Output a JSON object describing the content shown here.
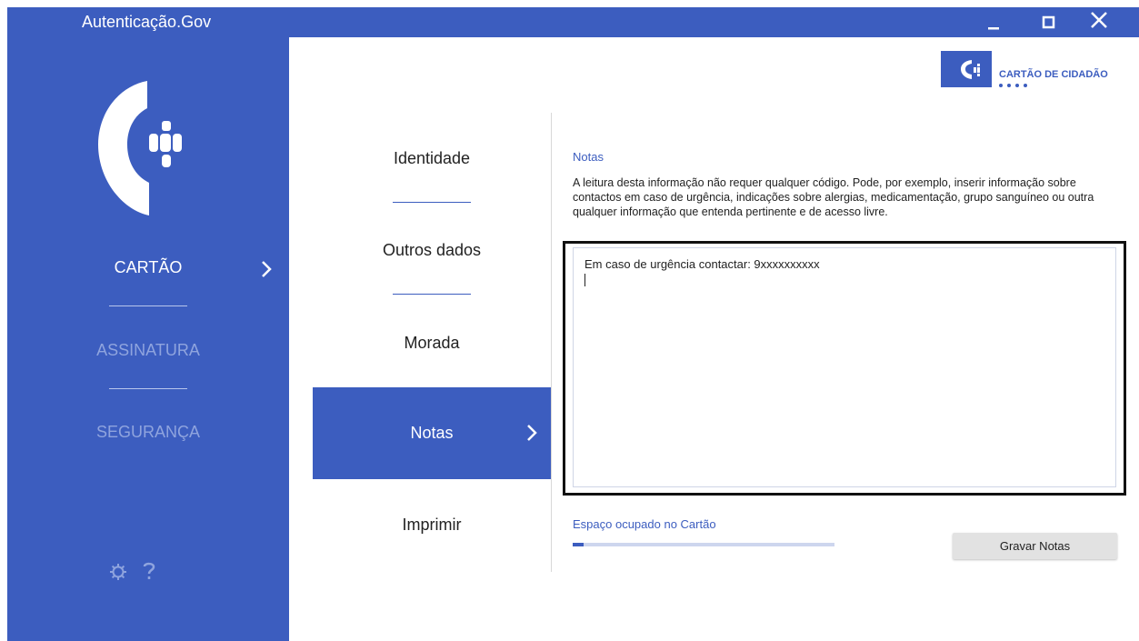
{
  "window": {
    "title": "Autenticação.Gov"
  },
  "sidebar": {
    "items": [
      {
        "label": "CARTÃO",
        "active": true
      },
      {
        "label": "ASSINATURA",
        "active": false
      },
      {
        "label": "SEGURANÇA",
        "active": false
      }
    ],
    "bottom_icons": [
      "gear-icon",
      "help-icon"
    ]
  },
  "subnav": {
    "items": [
      {
        "label": "Identidade",
        "active": false
      },
      {
        "label": "Outros dados",
        "active": false
      },
      {
        "label": "Morada",
        "active": false
      },
      {
        "label": "Notas",
        "active": true
      },
      {
        "label": "Imprimir",
        "active": false
      }
    ]
  },
  "brand": {
    "text": "CARTÃO DE CIDADÃO"
  },
  "notes": {
    "title": "Notas",
    "description": "A leitura desta informação não requer qualquer código. Pode, por exemplo, inserir informação sobre contactos em caso de urgência, indicações sobre alergias, medicamentação, grupo sanguíneo ou outra qualquer informação que entenda pertinente e de acesso livre.",
    "text": "Em caso de urgência contactar: 9xxxxxxxxxx"
  },
  "space": {
    "label": "Espaço ocupado no Cartão",
    "fraction": 0.04
  },
  "save_label": "Gravar Notas",
  "colors": {
    "accent": "#3c5dbf",
    "sidebar_inactive": "#8fa4de",
    "button": "#e2e2e2"
  }
}
